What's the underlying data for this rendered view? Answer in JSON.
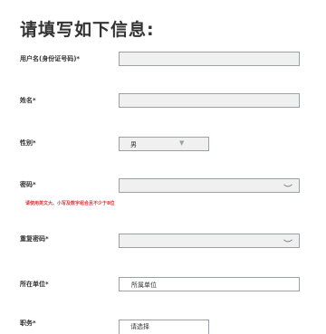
{
  "form": {
    "heading": "请填写如下信息:",
    "fields": {
      "id_number": {
        "label": "用户名(身份证号码)*",
        "value": ""
      },
      "name": {
        "label": "姓名*",
        "value": ""
      },
      "gender": {
        "label": "性别*",
        "selected": "男",
        "caret": "▼"
      },
      "password": {
        "label": "密码*",
        "value": "",
        "hint": "请使用英文大、小写及数字组合且不少于8位"
      },
      "confirm_password": {
        "label": "重复密码*",
        "value": ""
      },
      "work_unit": {
        "label": "所在单位*",
        "placeholder": "所属单位"
      },
      "position": {
        "label": "职务*",
        "selected": "请选择"
      }
    }
  },
  "icons": {
    "password_toggle": "eye-closed-icon"
  }
}
